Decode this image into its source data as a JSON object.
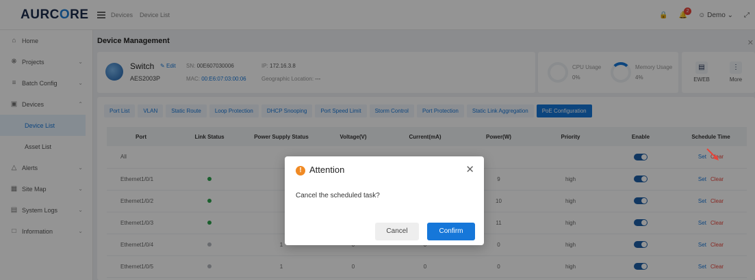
{
  "brand": {
    "logo_prefix": "AURC",
    "logo_o": "O",
    "logo_suffix": "RE"
  },
  "breadcrumbs": [
    "Devices",
    "Device List"
  ],
  "user": {
    "name": "Demo",
    "notification_count": "2"
  },
  "sidebar": {
    "items": [
      {
        "label": "Home",
        "icon": "home-icon"
      },
      {
        "label": "Projects",
        "icon": "projects-icon"
      },
      {
        "label": "Batch Config",
        "icon": "batch-config-icon"
      },
      {
        "label": "Devices",
        "icon": "devices-icon"
      },
      {
        "label": "Alerts",
        "icon": "alerts-icon"
      },
      {
        "label": "Site Map",
        "icon": "site-map-icon"
      },
      {
        "label": "System Logs",
        "icon": "system-logs-icon"
      },
      {
        "label": "Information",
        "icon": "information-icon"
      }
    ],
    "sub_devices": [
      "Device List",
      "Asset List"
    ]
  },
  "page": {
    "title": "Device Management"
  },
  "device": {
    "name": "Switch",
    "edit_label": "Edit",
    "model": "AES2003P",
    "sn_label": "SN:",
    "sn": "00E607030006",
    "mac_label": "MAC:",
    "mac": "00:E6:07:03:00:06",
    "ip_label": "IP:",
    "ip": "172.16.3.8",
    "location_label": "Geographic Location:",
    "location": "---"
  },
  "stats": {
    "cpu_label": "CPU Usage",
    "cpu_value": "0%",
    "mem_label": "Memory Usage",
    "mem_value": "4%"
  },
  "tools": {
    "eweb_label": "EWEB",
    "more_label": "More"
  },
  "tabs": [
    "Port List",
    "VLAN",
    "Static Route",
    "Loop Protection",
    "DHCP Snooping",
    "Port Speed Limit",
    "Storm Control",
    "Port Protection",
    "Static Link Aggregation",
    "PoE Configuration"
  ],
  "active_tab": "PoE Configuration",
  "table": {
    "headers": [
      "Port",
      "Link Status",
      "Power Supply Status",
      "Voltage(V)",
      "Current(mA)",
      "Power(W)",
      "Priority",
      "Enable",
      "Schedule Time"
    ],
    "set_label": "Set",
    "clear_label": "Clear",
    "rows": [
      {
        "port": "All",
        "link": "",
        "supply": "",
        "voltage": "",
        "current": "",
        "power": "",
        "priority": ""
      },
      {
        "port": "Ethernet1/0/1",
        "link": "up",
        "supply": "",
        "voltage": "",
        "current": "",
        "power": "9",
        "priority": "high"
      },
      {
        "port": "Ethernet1/0/2",
        "link": "up",
        "supply": "",
        "voltage": "",
        "current": "",
        "power": "10",
        "priority": "high"
      },
      {
        "port": "Ethernet1/0/3",
        "link": "up",
        "supply": "",
        "voltage": "",
        "current": "",
        "power": "11",
        "priority": "high"
      },
      {
        "port": "Ethernet1/0/4",
        "link": "down",
        "supply": "1",
        "voltage": "0",
        "current": "0",
        "power": "0",
        "priority": "high"
      },
      {
        "port": "Ethernet1/0/5",
        "link": "down",
        "supply": "1",
        "voltage": "0",
        "current": "0",
        "power": "0",
        "priority": "high"
      }
    ]
  },
  "dialog": {
    "title": "Attention",
    "message": "Cancel the scheduled task?",
    "cancel_label": "Cancel",
    "confirm_label": "Confirm"
  },
  "colors": {
    "primary": "#1677d9",
    "danger": "#e8443a",
    "warning": "#f08a24",
    "link_up": "#2da44e"
  }
}
